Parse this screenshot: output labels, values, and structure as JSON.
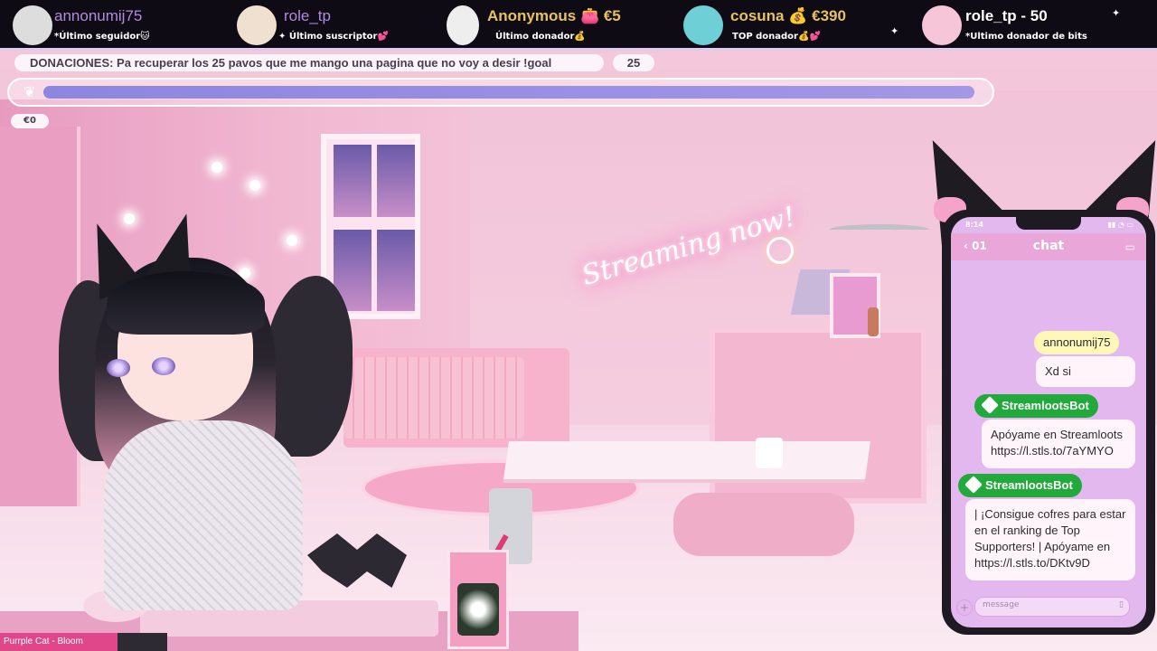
{
  "alerts": [
    {
      "name": "annonumij75",
      "label": "*Último seguidor",
      "emoji": "🐱",
      "style": "purple"
    },
    {
      "name": "role_tp",
      "label": "Último suscriptor",
      "emoji": "💕",
      "style": "purple"
    },
    {
      "name": "Anonymous 👛 €5",
      "label": "Último donador",
      "emoji": "💰",
      "style": "gold"
    },
    {
      "name": "cosuna 💰 €390",
      "label": "TOP donador",
      "emoji": "💰💕",
      "style": "gold"
    },
    {
      "name": "role_tp - 50",
      "label": "*Ultimo donador de bits",
      "emoji": "",
      "style": "white"
    }
  ],
  "goal": {
    "label": "DONACIONES: Pa recuperar los 25 pavos que me mango una pagina que no voy a desir !goal",
    "target": "25",
    "current": "€0",
    "progress": 0.99,
    "icon": "butterfly-icon"
  },
  "scene": {
    "neon_sign": "Streaming now!"
  },
  "chat": {
    "time": "8:14",
    "title": "chat",
    "back": "‹ 01",
    "input_placeholder": "message",
    "messages": [
      {
        "user": "annonumij75",
        "type": "user",
        "text": "Xd si"
      },
      {
        "user": "StreamlootsBot",
        "type": "bot",
        "text": "Apóyame en Streamloots https://l.stls.to/7aYMYO"
      },
      {
        "user": "StreamlootsBot",
        "type": "bot",
        "text": "| ¡Consigue cofres para estar en el ranking de Top Supporters! | Apóyame en https://l.stls.to/DKtv9D"
      }
    ]
  },
  "music": {
    "now_playing": "Purrple Cat - Bloom"
  },
  "colors": {
    "accent": "#b28ae0",
    "gold": "#e8c25e",
    "bot": "#22a93c",
    "goal_fill": "#8d86e0",
    "music": "#e0478a"
  }
}
